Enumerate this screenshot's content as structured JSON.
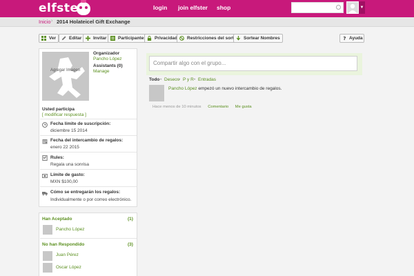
{
  "header": {
    "logo": "elfster",
    "nav": {
      "login": "login",
      "join": "join elfster",
      "shop": "shop"
    },
    "search_placeholder": "",
    "brand_color": "#c8197b"
  },
  "breadcrumb": {
    "home": "Inicio",
    "separator": "›",
    "current": "2014 Holateicel Gift Exchange"
  },
  "toolbar": {
    "ver": "Ver",
    "editar": "Editar",
    "invitar": "Invitar",
    "participantes": "Participantes",
    "privacidad": "Privacidad",
    "restricciones": "Restricciones del sorteo",
    "sortear": "Sortear Nombres",
    "ayuda": "Ayuda"
  },
  "profile": {
    "photo_label": "Agregar Imagen",
    "organizer_label": "Organizador",
    "organizer_name": "Pancho López",
    "assistants_label": "Assistants (0)",
    "manage": "Manage",
    "participation": "Usted participa",
    "modify": "[ modificar respuesta ]"
  },
  "details": [
    {
      "icon": "clock-icon",
      "label": "Fecha límite de suscripción:",
      "value": "diciembre 15 2014"
    },
    {
      "icon": "calendar-icon",
      "label": "Fecha del intercambio de regalos:",
      "value": "enero 22 2015"
    },
    {
      "icon": "rules-icon",
      "label": "Rules:",
      "value": "Regala una sonrisa"
    },
    {
      "icon": "money-icon",
      "label": "Límite de gasto:",
      "value": "MXN $100,00"
    },
    {
      "icon": "delivery-icon",
      "label": "Cómo se entregarán los regalos:",
      "value": "Individualmente o por correo electrónico."
    }
  ],
  "groups": {
    "accepted": {
      "label": "Han Aceptado",
      "count": "(1)",
      "members": [
        "Pancho López"
      ]
    },
    "pending": {
      "label": "No han Respondido",
      "count": "(3)",
      "members": [
        "Juan Pérez",
        "Oscar López"
      ]
    }
  },
  "compose": {
    "placeholder": "Compartir algo con el grupo..."
  },
  "filters": {
    "all": "Todo",
    "wishes": "Deseos",
    "qa": "P y R",
    "entries": "Entradas",
    "sep": "•"
  },
  "feed": {
    "author": "Pancho López",
    "action": " empezó un nuevo intercambio de regalos.",
    "time": "Hace menos de 10 minutos",
    "comment": "Comentario",
    "like": "Me gusta"
  }
}
